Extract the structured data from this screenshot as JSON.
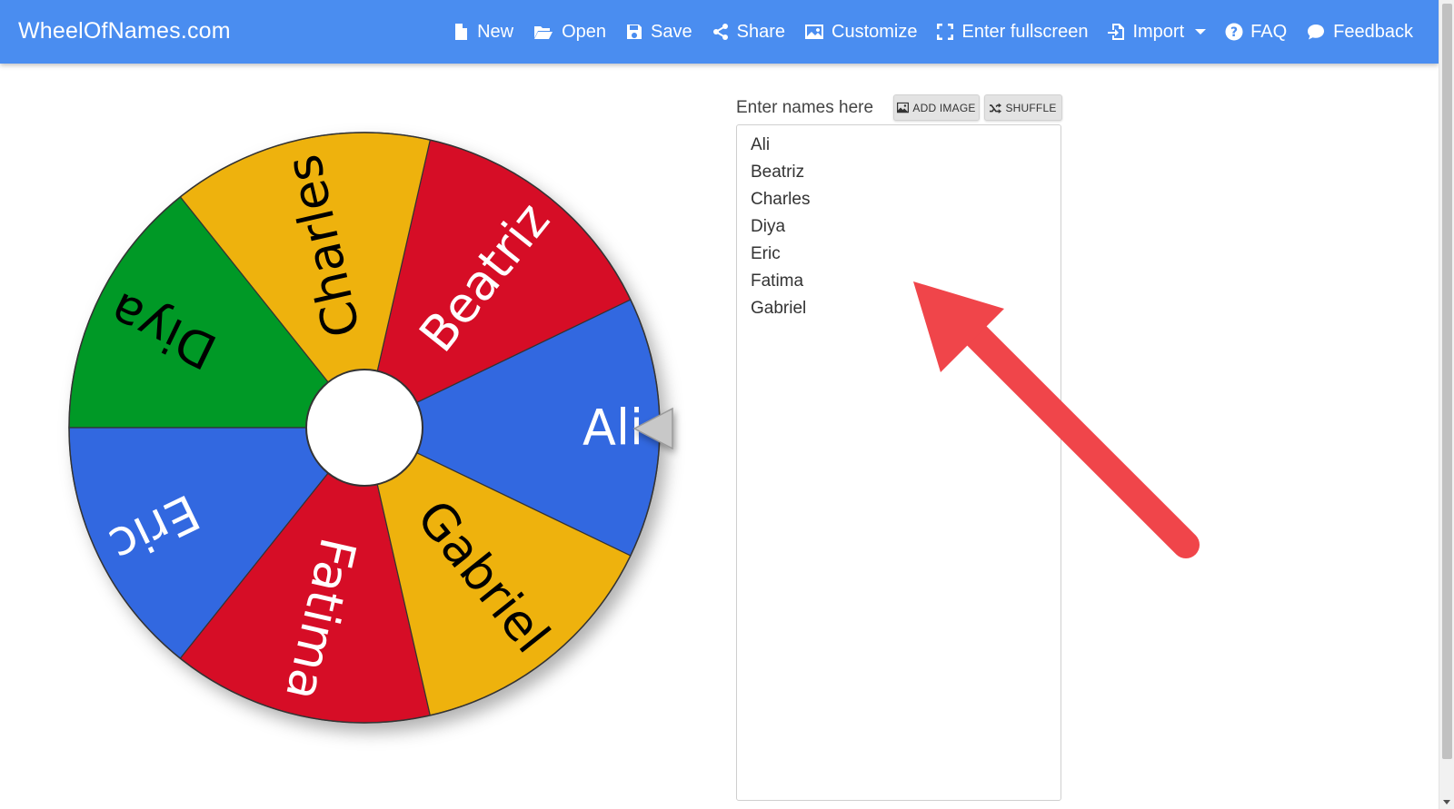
{
  "navbar": {
    "brand": "WheelOfNames.com",
    "items": [
      {
        "label": "New",
        "icon": "file-icon"
      },
      {
        "label": "Open",
        "icon": "folder-open-icon"
      },
      {
        "label": "Save",
        "icon": "save-icon"
      },
      {
        "label": "Share",
        "icon": "share-icon"
      },
      {
        "label": "Customize",
        "icon": "image-icon"
      },
      {
        "label": "Enter fullscreen",
        "icon": "fullscreen-icon"
      },
      {
        "label": "Import",
        "icon": "import-icon"
      },
      {
        "label": "FAQ",
        "icon": "question-circle-icon"
      },
      {
        "label": "Feedback",
        "icon": "comment-icon"
      }
    ],
    "color": "#4a8df0"
  },
  "wheel": {
    "segments": [
      {
        "name": "Ali",
        "color": "#3367e0",
        "text_color": "#ffffff"
      },
      {
        "name": "Beatriz",
        "color": "#d61128",
        "text_color": "#ffffff"
      },
      {
        "name": "Charles",
        "color": "#eeb211",
        "text_color": "#000000"
      },
      {
        "name": "Diya",
        "color": "#009925",
        "text_color": "#000000"
      },
      {
        "name": "Eric",
        "color": "#3367e0",
        "text_color": "#ffffff"
      },
      {
        "name": "Fatima",
        "color": "#d61128",
        "text_color": "#ffffff"
      },
      {
        "name": "Gabriel",
        "color": "#eeb211",
        "text_color": "#000000"
      }
    ],
    "pointer_color": "#c8c8c8"
  },
  "editor": {
    "label": "Enter names here",
    "add_image_label": "ADD IMAGE",
    "shuffle_label": "SHUFFLE",
    "names": [
      "Ali",
      "Beatriz",
      "Charles",
      "Diya",
      "Eric",
      "Fatima",
      "Gabriel"
    ]
  },
  "annotation": {
    "arrow_color": "#f0454a"
  }
}
